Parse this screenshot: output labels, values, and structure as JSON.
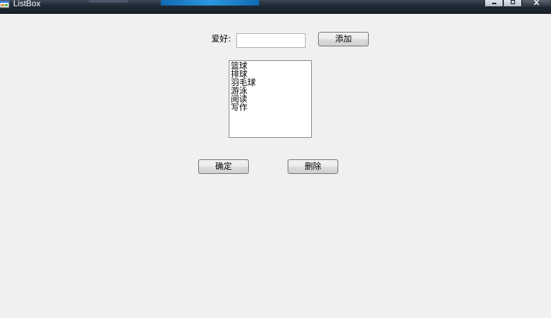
{
  "window": {
    "title": "ListBox",
    "app_icon": "winforms-app-icon",
    "controls": {
      "minimize": "minimize-icon",
      "maximize": "maximize-icon",
      "close": "close-icon"
    }
  },
  "form": {
    "hobby_label": "爱好:",
    "hobby_input_value": "",
    "add_button": "添加",
    "list_items": [
      "篮球",
      "排球",
      "羽毛球",
      "游泳",
      "阅读",
      "写作"
    ],
    "ok_button": "确定",
    "delete_button": "删除"
  }
}
